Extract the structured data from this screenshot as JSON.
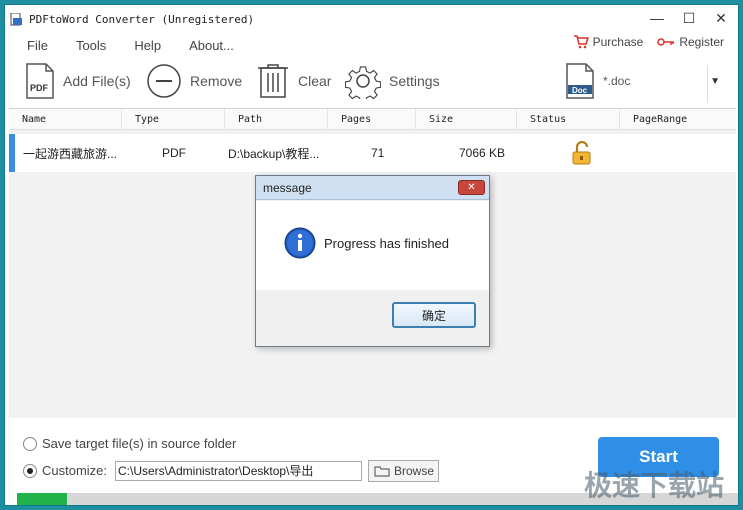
{
  "window": {
    "title": "PDFtoWord Converter (Unregistered)"
  },
  "menu": [
    "File",
    "Tools",
    "Help",
    "About..."
  ],
  "links": {
    "purchase": "Purchase",
    "register": "Register"
  },
  "toolbar": {
    "add": "Add File(s)",
    "remove": "Remove",
    "clear": "Clear",
    "settings": "Settings",
    "output_format": "*.doc"
  },
  "table": {
    "columns": [
      "Name",
      "Type",
      "Path",
      "Pages",
      "Size",
      "Status",
      "PageRange"
    ],
    "rows": [
      {
        "name": "一起游西藏旅游...",
        "type": "PDF",
        "path": "D:\\backup\\教程...",
        "pages": "71",
        "size": "7066 KB",
        "status": "lock-open",
        "range": ""
      }
    ]
  },
  "dialog": {
    "title": "message",
    "message": "Progress has finished",
    "ok": "确定"
  },
  "output": {
    "option_source": "Save target file(s) in source folder",
    "option_custom": "Customize:",
    "path": "C:\\Users\\Administrator\\Desktop\\导出",
    "browse": "Browse",
    "start": "Start",
    "progress_fraction": 0.07,
    "selected_option": "custom"
  },
  "watermark": "极速下载站",
  "colors": {
    "accent": "#2f8fe6",
    "progress": "#22b24a",
    "row_marker": "#3a8de0"
  }
}
